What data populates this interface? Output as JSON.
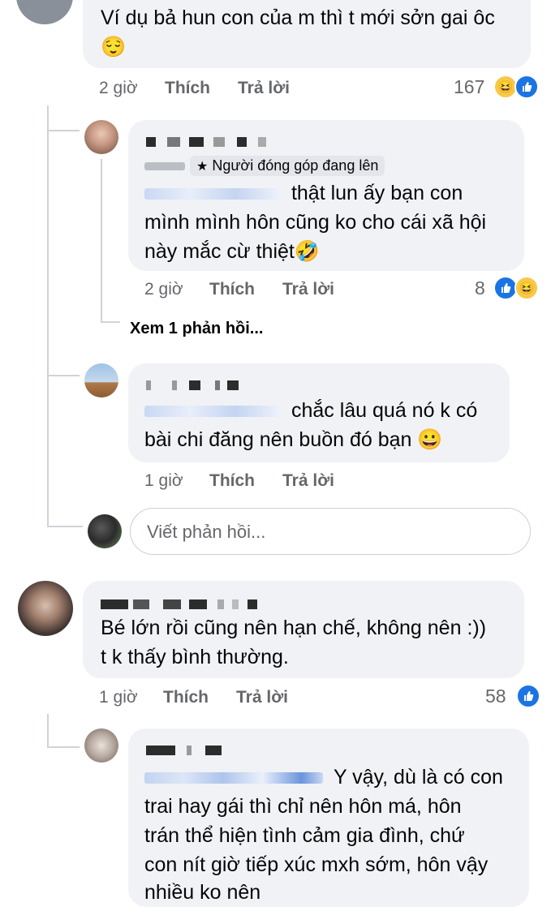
{
  "c1": {
    "text_line1": "Ví dụ bả hun con của m thì t mới sởn gai ôc",
    "emoji": "😌",
    "time": "2 giờ",
    "like": "Thích",
    "reply": "Trả lời",
    "count": "167"
  },
  "r1": {
    "badge": "Người đóng góp đang lên",
    "text_part1": "thật lun ấy bạn con",
    "text_line2": "mình mình hôn cũng ko cho cái xã hội",
    "text_line3": "này mắc cừ thiệt🤣",
    "time": "2 giờ",
    "like": "Thích",
    "reply": "Trả lời",
    "count": "8"
  },
  "view_more": "Xem 1 phản hồi...",
  "r2": {
    "text_part1": "chắc lâu quá nó k có",
    "text_line2": "bài chi đăng nên buồn đó bạn 😀",
    "time": "1 giờ",
    "like": "Thích",
    "reply": "Trả lời"
  },
  "reply_box": {
    "placeholder": "Viết phản hồi..."
  },
  "c2": {
    "text_line1": "Bé lớn rồi cũng nên hạn chế, không nên :))",
    "text_line2": "t k thấy bình thường.",
    "time": "1 giờ",
    "like": "Thích",
    "reply": "Trả lời",
    "count": "58"
  },
  "r3": {
    "text_part1": "Y vậy, dù là có con",
    "text_line2": "trai hay gái thì chỉ nên hôn má, hôn",
    "text_line3": "trán thể hiện tình cảm gia đình, chứ",
    "text_line4": "con nít giờ tiếp xúc mxh sớm, hôn vậy",
    "text_line5": "nhiều ko nên"
  },
  "colors": {
    "like_blue": "#1b74e4",
    "bubble_gray": "#f0f2f5",
    "meta_gray": "#65676b"
  }
}
